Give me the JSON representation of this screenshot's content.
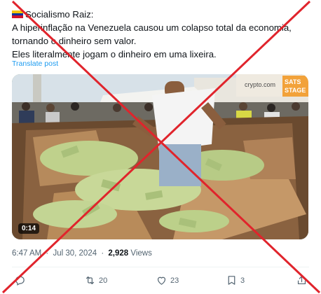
{
  "post": {
    "author": "Socialismo Raiz:",
    "lines": [
      "A hiperinflação na Venezuela causou um colapso total da economia,",
      "tornando o dinheiro sem valor.",
      "Eles literalmente jogam o dinheiro em uma lixeira."
    ],
    "translate_label": "Translate post",
    "flag_colors": [
      "#f5c400",
      "#0033a0",
      "#cf142b"
    ]
  },
  "media": {
    "duration": "0:14",
    "sign_left": "crypto.com",
    "sign_right_1": "SATS",
    "sign_right_2": "STAGE"
  },
  "meta": {
    "time": "6:47 AM",
    "date": "Jul 30, 2024",
    "separator": "·",
    "views_count": "2,928",
    "views_label": "Views"
  },
  "actions": {
    "reply_count": "",
    "retweet_count": "20",
    "like_count": "23",
    "bookmark_count": "3"
  },
  "overlay": {
    "cross_color": "#e0242c"
  }
}
